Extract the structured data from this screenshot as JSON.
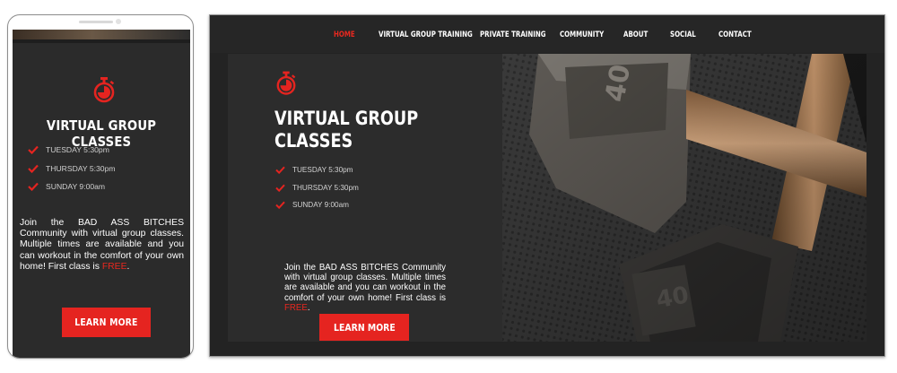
{
  "colors": {
    "accent": "#e52420",
    "background_dark": "#2c2c2c",
    "text": "#ffffff"
  },
  "mobile": {
    "title": "VIRTUAL GROUP CLASSES",
    "schedule": [
      "TUESDAY 5:30pm",
      "THURSDAY 5:30pm",
      "SUNDAY 9:00am"
    ],
    "description": "Join the BAD ASS BITCHES Community with virtual group classes. Multiple times are available and you can workout in the comfort of your own home! First class is ",
    "free_text": "FREE",
    "description_end": ".",
    "cta_label": "LEARN MORE"
  },
  "desktop": {
    "nav": {
      "items": [
        "HOME",
        "VIRTUAL GROUP TRAINING",
        "PRIVATE TRAINING",
        "COMMUNITY",
        "ABOUT",
        "SOCIAL",
        "CONTACT"
      ],
      "active": "HOME"
    },
    "title_line1": "VIRTUAL GROUP",
    "title_line2": "CLASSES",
    "schedule": [
      "TUESDAY 5:30pm",
      "THURSDAY 5:30pm",
      "SUNDAY 9:00am"
    ],
    "description": "Join the BAD ASS BITCHES Community with virtual group classes. Multiple times are available and you can workout in the comfort of your own home! First class is ",
    "free_text": "FREE",
    "description_end": ".",
    "cta_label": "LEARN MORE",
    "hero_image": {
      "dumbbell_weight_label": "40"
    }
  }
}
